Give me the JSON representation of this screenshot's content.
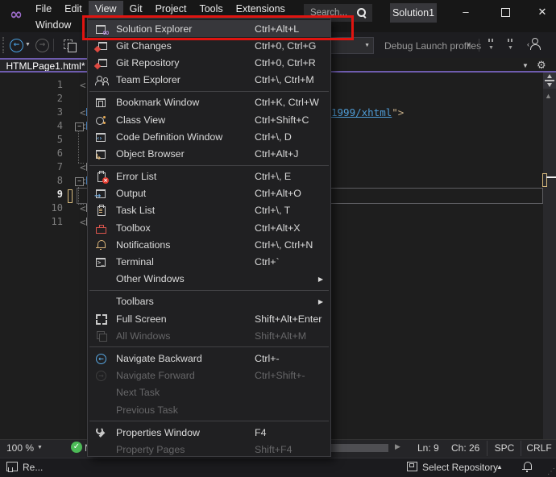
{
  "title_bar": {
    "menus_row1": [
      "File",
      "Edit",
      "View",
      "Git",
      "Project",
      "Tools",
      "Extensions"
    ],
    "active_menu": "View",
    "menus_row2": [
      "Window"
    ],
    "search_placeholder": "Search...",
    "solution_badge": "Solution1",
    "window_controls": {
      "minimize": "–",
      "close": "✕"
    }
  },
  "toolbar": {
    "debug_launch_profiles_label": "Debug Launch profiles"
  },
  "view_menu": {
    "items": [
      {
        "type": "item",
        "label": "Solution Explorer",
        "shortcut": "Ctrl+Alt+L",
        "icon": "solution-explorer",
        "highlighted": true,
        "annotated": true
      },
      {
        "type": "item",
        "label": "Git Changes",
        "shortcut": "Ctrl+0, Ctrl+G",
        "icon": "git-changes"
      },
      {
        "type": "item",
        "label": "Git Repository",
        "shortcut": "Ctrl+0, Ctrl+R",
        "icon": "git-repository"
      },
      {
        "type": "item",
        "label": "Team Explorer",
        "shortcut": "Ctrl+\\, Ctrl+M",
        "icon": "team-explorer"
      },
      {
        "type": "separator"
      },
      {
        "type": "item",
        "label": "Bookmark Window",
        "shortcut": "Ctrl+K, Ctrl+W",
        "icon": "bookmark-window"
      },
      {
        "type": "item",
        "label": "Class View",
        "shortcut": "Ctrl+Shift+C",
        "icon": "class-view"
      },
      {
        "type": "item",
        "label": "Code Definition Window",
        "shortcut": "Ctrl+\\, D",
        "icon": "code-definition-window"
      },
      {
        "type": "item",
        "label": "Object Browser",
        "shortcut": "Ctrl+Alt+J",
        "icon": "object-browser"
      },
      {
        "type": "separator"
      },
      {
        "type": "item",
        "label": "Error List",
        "shortcut": "Ctrl+\\, E",
        "icon": "error-list"
      },
      {
        "type": "item",
        "label": "Output",
        "shortcut": "Ctrl+Alt+O",
        "icon": "output"
      },
      {
        "type": "item",
        "label": "Task List",
        "shortcut": "Ctrl+\\, T",
        "icon": "task-list"
      },
      {
        "type": "item",
        "label": "Toolbox",
        "shortcut": "Ctrl+Alt+X",
        "icon": "toolbox"
      },
      {
        "type": "item",
        "label": "Notifications",
        "shortcut": "Ctrl+\\, Ctrl+N",
        "icon": "notifications"
      },
      {
        "type": "item",
        "label": "Terminal",
        "shortcut": "Ctrl+`",
        "icon": "terminal"
      },
      {
        "type": "item",
        "label": "Other Windows",
        "shortcut": "",
        "submenu": true
      },
      {
        "type": "separator"
      },
      {
        "type": "item",
        "label": "Toolbars",
        "shortcut": "",
        "submenu": true
      },
      {
        "type": "item",
        "label": "Full Screen",
        "shortcut": "Shift+Alt+Enter",
        "icon": "full-screen"
      },
      {
        "type": "item",
        "label": "All Windows",
        "shortcut": "Shift+Alt+M",
        "icon": "all-windows",
        "disabled": true
      },
      {
        "type": "separator"
      },
      {
        "type": "item",
        "label": "Navigate Backward",
        "shortcut": "Ctrl+-",
        "icon": "navigate-backward"
      },
      {
        "type": "item",
        "label": "Navigate Forward",
        "shortcut": "Ctrl+Shift+-",
        "icon": "navigate-forward",
        "disabled": true
      },
      {
        "type": "item",
        "label": "Next Task",
        "shortcut": "",
        "disabled": true
      },
      {
        "type": "item",
        "label": "Previous Task",
        "shortcut": "",
        "disabled": true
      },
      {
        "type": "separator"
      },
      {
        "type": "item",
        "label": "Properties Window",
        "shortcut": "F4",
        "icon": "properties-window"
      },
      {
        "type": "item",
        "label": "Property Pages",
        "shortcut": "Shift+F4",
        "disabled": true
      }
    ]
  },
  "annotation": {
    "shape": "rectangle",
    "color": "#e01410",
    "target": "Solution Explorer menu item"
  },
  "editor": {
    "tab_label": "HTMLPage1.html*",
    "line_numbers": [
      1,
      2,
      3,
      4,
      5,
      6,
      7,
      8,
      9,
      10,
      11
    ],
    "current_line": 9,
    "code_left_fragments": [
      {
        "n": 1,
        "text": "<"
      },
      {
        "n": 3,
        "text": "<",
        "sliver": "blue"
      },
      {
        "n": 4,
        "text": "<",
        "sliver": "blue",
        "fold": true
      },
      {
        "n": 7,
        "text": "<",
        "sliver": "gray"
      },
      {
        "n": 8,
        "text": "<",
        "sliver": "blue",
        "fold": true
      },
      {
        "n": 10,
        "text": "<",
        "sliver": "gray"
      },
      {
        "n": 11,
        "text": "<",
        "sliver": "gray"
      }
    ],
    "code_right_fragment": {
      "line": 3,
      "link_text": "1999/xhtml",
      "tail": "\">"
    }
  },
  "editor_status": {
    "zoom": "100 %",
    "health_partial": "N",
    "line_indicator": "Ln: 9",
    "char_indicator": "Ch: 26",
    "spaces_indicator": "SPC",
    "line_ending": "CRLF"
  },
  "status_bar": {
    "left_text": "Re...",
    "repository_label": "Select Repository"
  },
  "colors": {
    "accent_purple": "#6e5cae",
    "annotation_red": "#e01410",
    "git_red": "#dd4840",
    "icon_gold": "#dcb67a",
    "icon_blue": "#6ea8dc",
    "nav_blue": "#58a6e0",
    "health_green": "#4cbb57"
  }
}
